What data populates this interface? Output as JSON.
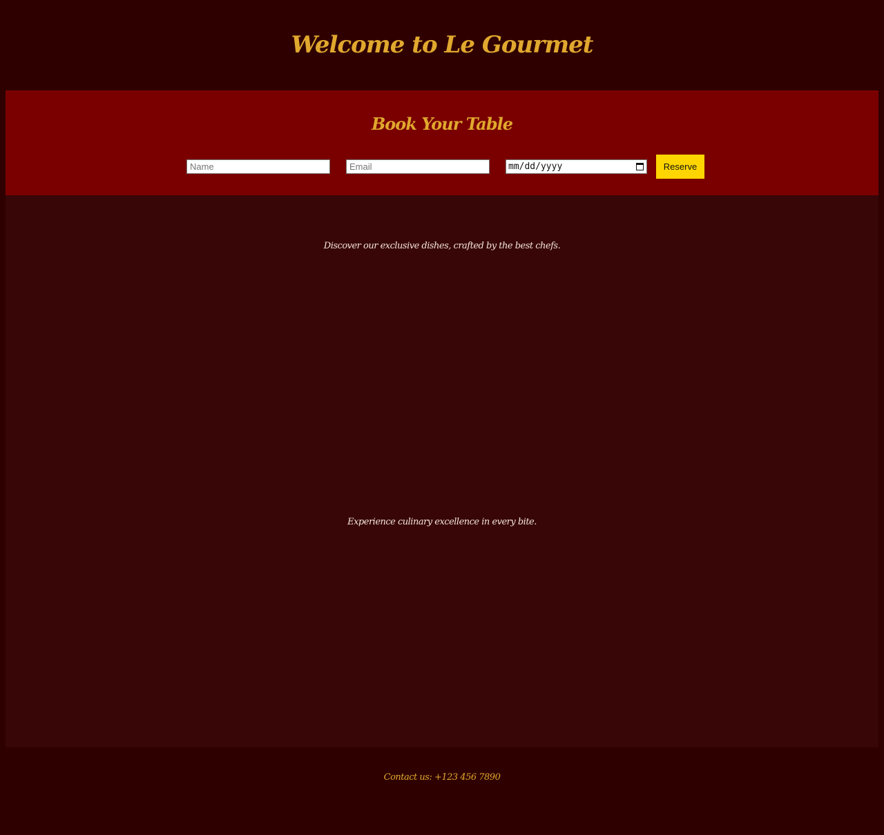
{
  "header": {
    "title": "Welcome to Le Gourmet"
  },
  "booking": {
    "title": "Book Your Table",
    "name_placeholder": "Name",
    "email_placeholder": "Email",
    "date_placeholder": "mm/dd/yyyy",
    "reserve_label": "Reserve"
  },
  "main": {
    "tagline_1": "Discover our exclusive dishes, crafted by the best chefs.",
    "tagline_2": "Experience culinary excellence in every bite."
  },
  "footer": {
    "contact": "Contact us: +123 456 7890"
  },
  "colors": {
    "page_background": "#2f0000",
    "booking_background": "#7a0000",
    "main_background": "#380607",
    "accent_gold": "#e0a82e",
    "button_yellow": "#ffd500"
  },
  "icons": {
    "date_picker": "calendar-icon"
  }
}
